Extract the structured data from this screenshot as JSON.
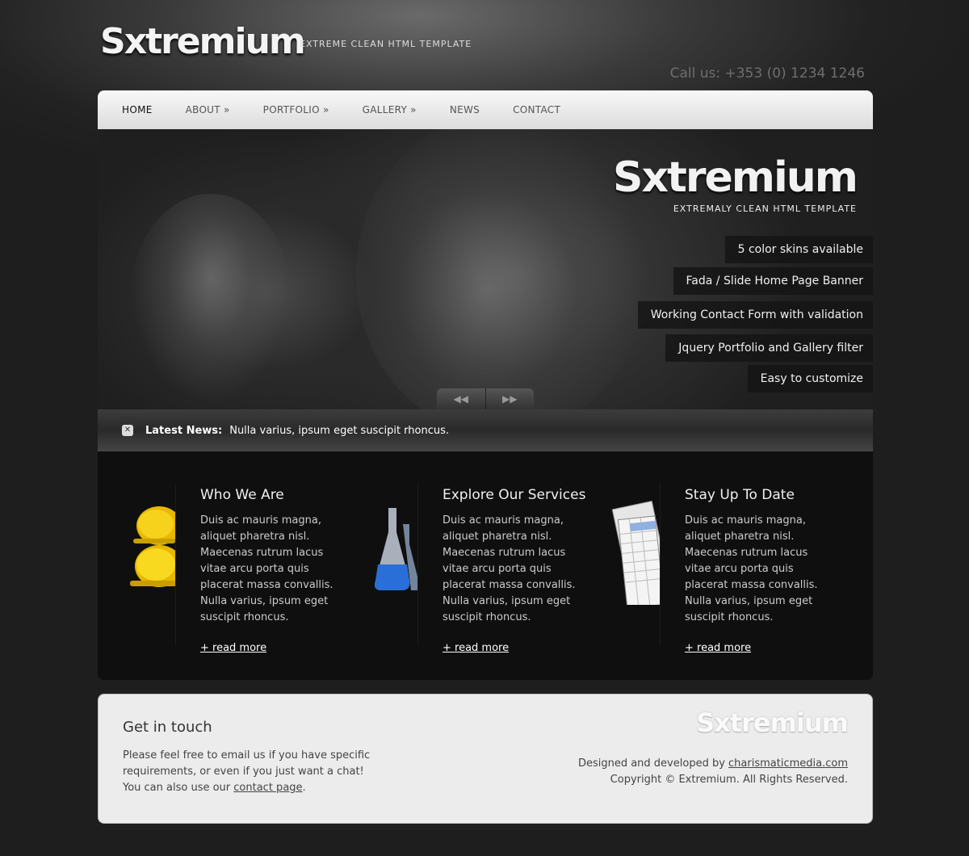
{
  "header": {
    "logo": "Sxtremium",
    "tagline": "EXTREME CLEAN HTML TEMPLATE",
    "call_us": "Call us: +353 (0) 1234 1246"
  },
  "nav": {
    "items": [
      {
        "label": "HOME"
      },
      {
        "label": "ABOUT »"
      },
      {
        "label": "PORTFOLIO »"
      },
      {
        "label": "GALLERY »"
      },
      {
        "label": "NEWS"
      },
      {
        "label": "CONTACT"
      }
    ],
    "active": "HOME"
  },
  "banner": {
    "logo": "Sxtremium",
    "tagline": "EXTREMALY CLEAN HTML TEMPLATE",
    "features": [
      "5 color skins available",
      "Fada / Slide Home Page Banner",
      "Working Contact Form with validation",
      "Jquery Portfolio and Gallery filter",
      "Easy to customize"
    ],
    "prev_glyph": "◀◀",
    "next_glyph": "▶▶"
  },
  "news": {
    "icon": "close-icon",
    "label": "Latest News:",
    "text": "Nulla varius, ipsum eget suscipit rhoncus."
  },
  "columns": [
    {
      "icon": "helmet-icon",
      "title": "Who We Are",
      "text": "Duis ac mauris magna, aliquet pharetra nisl. Maecenas rutrum lacus vitae arcu porta quis placerat massa convallis. Nulla varius, ipsum eget suscipit rhoncus.",
      "link": "+ read more"
    },
    {
      "icon": "flask-icon",
      "title": "Explore Our Services",
      "text": "Duis ac mauris magna, aliquet pharetra nisl. Maecenas rutrum lacus vitae arcu porta quis placerat massa convallis. Nulla varius, ipsum eget suscipit rhoncus.",
      "link": "+ read more"
    },
    {
      "icon": "spreadsheet-icon",
      "title": "Stay Up To Date",
      "text": "Duis ac mauris magna, aliquet pharetra nisl. Maecenas rutrum lacus vitae arcu porta quis placerat massa convallis. Nulla varius, ipsum eget suscipit rhoncus.",
      "link": "+ read more"
    }
  ],
  "footer": {
    "title": "Get in touch",
    "text_before_link": "Please feel free to email us if you have specific requirements, or even if you just want a chat! You can also use our ",
    "contact_link": "contact page",
    "text_after_link": ".",
    "logo": "Sxtremium",
    "designed_by": "Designed and developed by ",
    "designer_link": "charismaticmedia.com",
    "copyright": "Copyright © Extremium. All Rights Reserved."
  },
  "colors": {
    "background": "#1e1e1e",
    "nav_bg": "#e8e8e8",
    "main_bg": "#0f0f0f",
    "footer_bg": "#ececec",
    "helmet": "#f5c400",
    "flask": "#2a6fd8"
  }
}
